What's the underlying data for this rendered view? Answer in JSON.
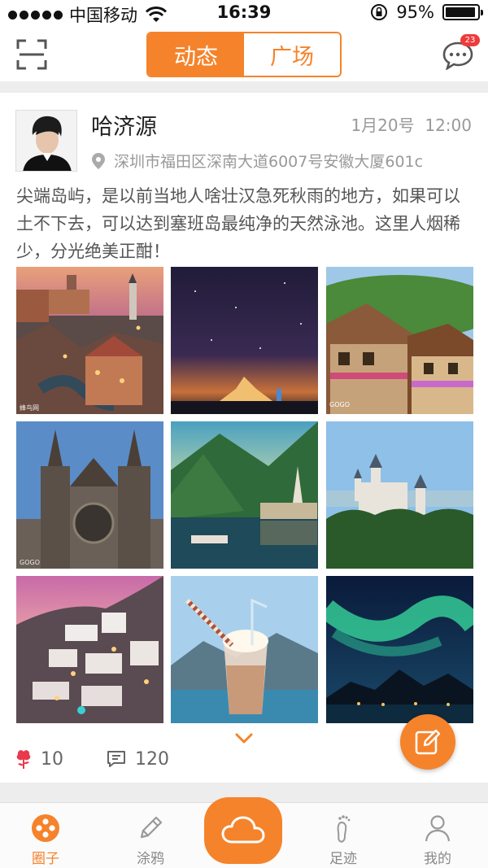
{
  "status_bar": {
    "carrier": "中国移动",
    "time": "16:39",
    "battery": "95%"
  },
  "nav": {
    "tabs": [
      {
        "label": "动态",
        "active": true
      },
      {
        "label": "广场",
        "active": false
      }
    ],
    "message_badge": "23"
  },
  "post": {
    "author": "哈济源",
    "date": "1月20号",
    "time": "12:00",
    "location": "深圳市福田区深南大道6007号安徽大厦601c",
    "text": "尖端岛屿，是以前当地人啥壮汉急死秋雨的地方，如果可以土不下去，可以达到塞班岛最纯净的天然泳池。这里人烟稀少，分光绝美正酣！",
    "likes": "10",
    "comments": "120",
    "photo_captions": [
      "蜂鸟网",
      "GOGO",
      "GOGO"
    ]
  },
  "tabbar": {
    "items": [
      "圈子",
      "涂鸦",
      "足迹",
      "我的"
    ]
  },
  "colors": {
    "accent": "#f5832b",
    "badge": "#f03a3a",
    "like": "#e83a4c"
  }
}
